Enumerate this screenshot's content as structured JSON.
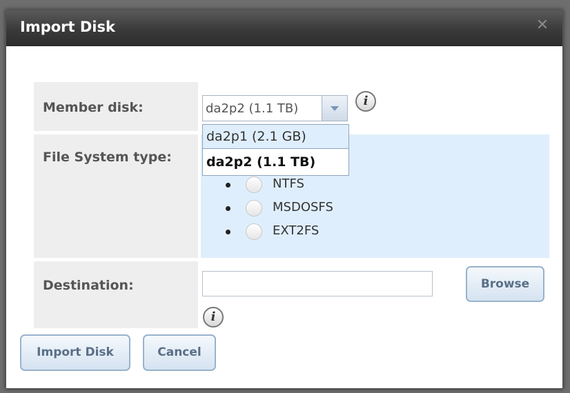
{
  "dialog": {
    "title": "Import Disk",
    "close_icon": "close-icon"
  },
  "form": {
    "member_disk": {
      "label": "Member disk:",
      "selected_value": "da2p2 (1.1 TB)",
      "options": [
        "da2p1 (2.1 GB)",
        "da2p2 (1.1 TB)"
      ],
      "highlighted_option": "da2p1 (2.1 GB)"
    },
    "fs_type": {
      "label": "File System type:",
      "options": [
        "NTFS",
        "MSDOSFS",
        "EXT2FS"
      ]
    },
    "destination": {
      "label": "Destination:",
      "value": "",
      "browse_label": "Browse"
    }
  },
  "buttons": {
    "import_label": "Import Disk",
    "cancel_label": "Cancel"
  },
  "info_glyph": "i",
  "colors": {
    "titlebar": "#3a3a3a",
    "label_cell": "#eeeeee",
    "panel_blue": "#dfeefc",
    "button_border": "#97b2cd"
  }
}
